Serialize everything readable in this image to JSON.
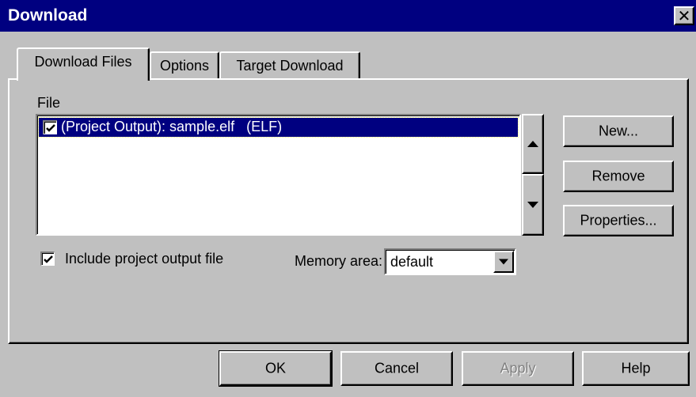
{
  "window": {
    "title": "Download",
    "close_icon": "close-icon"
  },
  "tabs": [
    {
      "label": "Download Files",
      "active": true
    },
    {
      "label": "Options",
      "active": false
    },
    {
      "label": "Target Download",
      "active": false
    }
  ],
  "files": {
    "section_label": "File",
    "items": [
      {
        "checked": true,
        "text": "(Project Output): sample.elf   (ELF)",
        "selected": true
      }
    ],
    "move_up_icon": "arrow-up-icon",
    "move_down_icon": "arrow-down-icon"
  },
  "side_buttons": {
    "new": "New...",
    "remove": "Remove",
    "properties": "Properties..."
  },
  "include_output": {
    "checked": true,
    "label": "Include project output file"
  },
  "memory_area": {
    "label": "Memory area:",
    "value": "default"
  },
  "footer": {
    "ok": "OK",
    "cancel": "Cancel",
    "apply": "Apply",
    "apply_disabled": true,
    "help": "Help"
  },
  "colors": {
    "face": "#c0c0c0",
    "titlebar": "#000080",
    "selection": "#000080"
  }
}
